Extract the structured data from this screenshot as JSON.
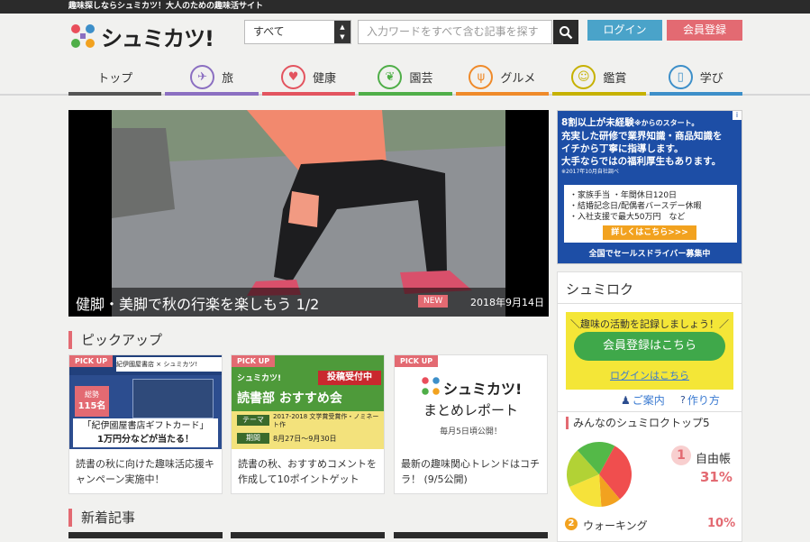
{
  "topbar": {
    "tagline": "趣味探しならシュミカツ！大人のための趣味活サイト"
  },
  "logo": {
    "text": "シュミカツ!"
  },
  "search": {
    "category": "すべて",
    "placeholder": "入力ワードをすべて含む記事を探す"
  },
  "header": {
    "login": "ログイン",
    "register": "会員登録"
  },
  "nav": [
    {
      "label": "トップ",
      "icon": "",
      "color": "#555555"
    },
    {
      "label": "旅",
      "icon": "airplane-icon",
      "color": "#8b6fc1"
    },
    {
      "label": "健康",
      "icon": "heart-hands-icon",
      "color": "#e3545f"
    },
    {
      "label": "園芸",
      "icon": "sprout-icon",
      "color": "#4fae48"
    },
    {
      "label": "グルメ",
      "icon": "cutlery-icon",
      "color": "#ef8a2a"
    },
    {
      "label": "鑑賞",
      "icon": "person-icon",
      "color": "#c6b100"
    },
    {
      "label": "学び",
      "icon": "book-icon",
      "color": "#3d8fc9"
    }
  ],
  "hero": {
    "title": "健脚・美脚で秋の行楽を楽しもう 1/2",
    "badge": "NEW",
    "date": "2018年9月14日"
  },
  "pickup": {
    "title": "ピックアップ",
    "cards": [
      {
        "badge": "PICK UP",
        "img_header": "紀伊國屋書店 × シュミカツ!",
        "img_total": "総勢",
        "img_count": "115名",
        "img_line1": "「紀伊國屋書店ギフトカード」",
        "img_line2": "1万円分などが当たる！",
        "text": "読書の秋に向けた趣味活応援キャンペーン実施中！"
      },
      {
        "badge": "PICK UP",
        "img_logo": "シュミカツ!",
        "img_tag": "投稿受付中",
        "img_title": "読書部 おすすめ会",
        "img_theme_label": "テーマ",
        "img_theme": "2017-2018 文学賞受賞作・ノミネート作",
        "img_period_label": "期間",
        "img_period": "8月27日～9月30日",
        "text": "読書の秋、おすすめコメントを作成して10ポイントゲット"
      },
      {
        "badge": "PICK UP",
        "img_logo": "シュミカツ!",
        "img_title": "まとめレポート",
        "img_sub": "毎月5日頃公開！",
        "text": "最新の趣味関心トレンドはコチラ！ (9/5公開)"
      }
    ]
  },
  "new_articles": {
    "title": "新着記事"
  },
  "ad": {
    "line1": "8割以上が未経験",
    "line1b": "※からのスタート。",
    "line2": "充実した研修で業界知識・商品知識を",
    "line3": "イチから丁寧に指導します。",
    "line4": "大手ならではの福利厚生もあります。",
    "note": "※2017年10月自社調べ",
    "bullets": [
      "・家族手当 ・年間休日120日",
      "・結婚記念日/配偶者バースデー休暇",
      "・入社支援で最大50万円　など"
    ],
    "cta": "詳しくはこちら>>>",
    "footer": "全国でセールスドライバー募集中",
    "info": "i"
  },
  "shumiroku": {
    "title": "シュミロク",
    "prompt": "＼趣味の活動を記録しましょう！／",
    "register": "会員登録はこちら",
    "login": "ログインはこちら",
    "guide": "ご案内",
    "howto": "作り方",
    "top5_title": "みんなのシュミロクトップ5",
    "rank1": {
      "rank": "1",
      "name": "自由帳",
      "pct": "31%"
    },
    "rank2": {
      "rank": "2",
      "name": "ウォーキング",
      "pct": "10%"
    }
  },
  "chart_data": {
    "type": "pie",
    "categories": [
      "自由帳",
      "ウォーキング",
      "",
      "",
      ""
    ],
    "values": [
      31,
      10,
      0,
      0,
      0
    ],
    "colors": [
      "#f04e4e",
      "#f2a21f",
      "#f6e23a",
      "#b2d235",
      "#54b948"
    ]
  }
}
